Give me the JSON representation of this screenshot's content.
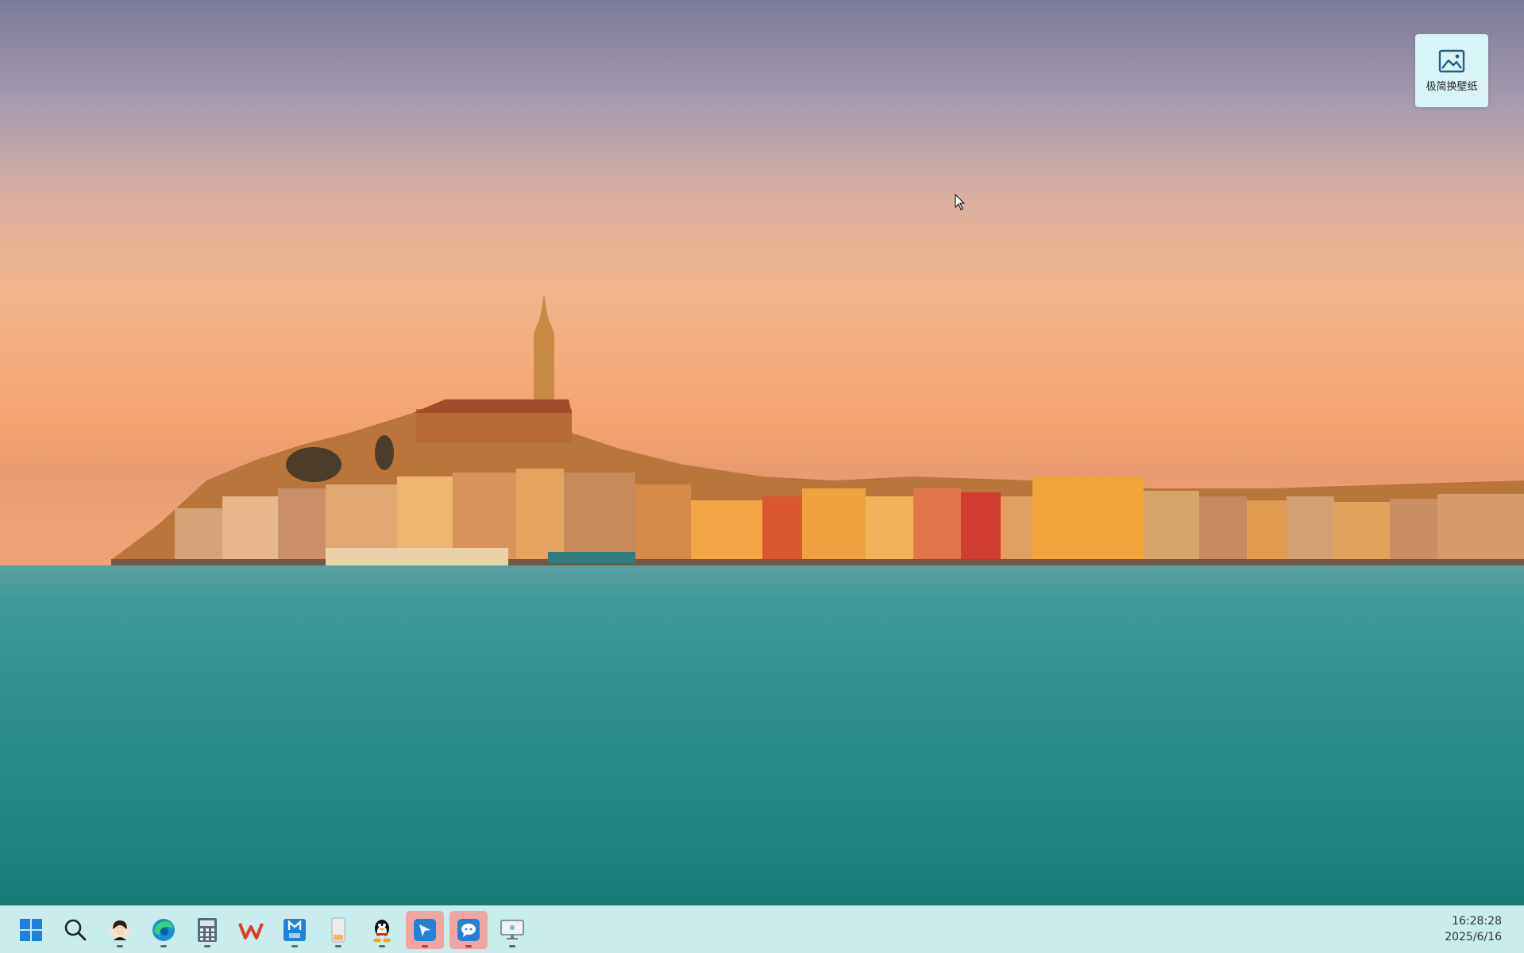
{
  "desktop": {
    "widget": {
      "label": "极简换壁纸",
      "icon": "image-icon"
    }
  },
  "taskbar": {
    "items": [
      {
        "name": "start-button",
        "icon": "windows-logo-icon",
        "active": false,
        "running": false
      },
      {
        "name": "search-button",
        "icon": "search-icon",
        "active": false,
        "running": false
      },
      {
        "name": "app-avatar",
        "icon": "avatar-app-icon",
        "active": false,
        "running": true
      },
      {
        "name": "app-edge",
        "icon": "edge-browser-icon",
        "active": false,
        "running": true
      },
      {
        "name": "app-calculator",
        "icon": "calculator-icon",
        "active": false,
        "running": true
      },
      {
        "name": "app-wps",
        "icon": "wps-office-icon",
        "active": false,
        "running": false
      },
      {
        "name": "app-m",
        "icon": "m-app-icon",
        "active": false,
        "running": true
      },
      {
        "name": "app-phone",
        "icon": "phone-icon",
        "active": false,
        "running": true
      },
      {
        "name": "app-qq",
        "icon": "qq-penguin-icon",
        "active": false,
        "running": true
      },
      {
        "name": "app-feishu",
        "icon": "paper-plane-icon",
        "active": true,
        "running": true
      },
      {
        "name": "app-chat",
        "icon": "chat-bubble-icon",
        "active": true,
        "running": true
      },
      {
        "name": "app-monitor",
        "icon": "monitor-icon",
        "active": false,
        "running": true
      }
    ],
    "clock": {
      "time": "16:28:28",
      "date": "2025/6/16"
    }
  },
  "colors": {
    "taskbar_bg": "#c9ecec",
    "active_item": "#f2a5a0",
    "widget_bg": "#d9f4f6"
  }
}
